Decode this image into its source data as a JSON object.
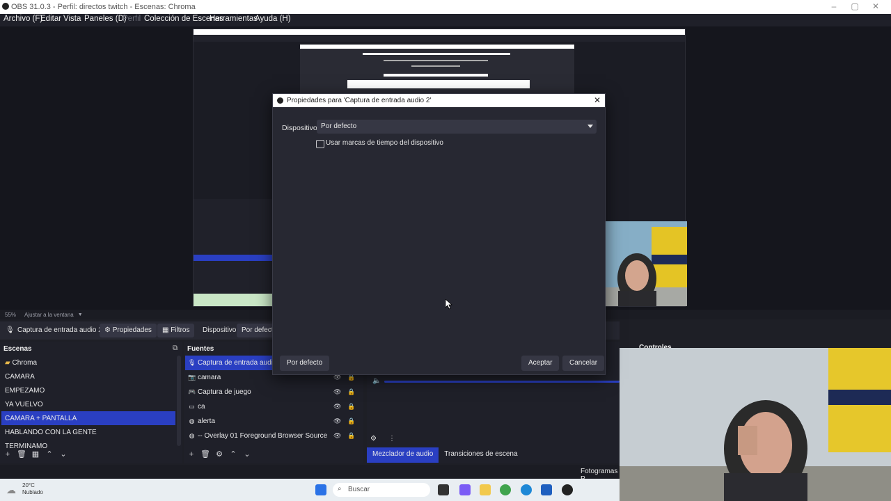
{
  "window": {
    "title": "OBS 31.0.3 - Perfil: directos twitch - Escenas: Chroma"
  },
  "menu": [
    {
      "label": "Archivo (F)",
      "enabled": true
    },
    {
      "label": "Editar",
      "enabled": true
    },
    {
      "label": "Vista",
      "enabled": true
    },
    {
      "label": "Paneles (D)",
      "enabled": true
    },
    {
      "label": "Perfil",
      "enabled": false
    },
    {
      "label": "Colección de Escenas",
      "enabled": true
    },
    {
      "label": "Herramientas",
      "enabled": true
    },
    {
      "label": "Ayuda (H)",
      "enabled": true
    }
  ],
  "preview": {
    "zoom": "55%",
    "fit_label": "Ajustar a la ventana"
  },
  "context_bar": {
    "source": "Captura de entrada audio 2",
    "properties": "Propiedades",
    "filters": "Filtros",
    "device_label": "Dispositivo",
    "device_value": "Por defecto"
  },
  "scenes": {
    "title": "Escenas",
    "items": [
      "Chroma",
      "CAMARA",
      "EMPEZAMO",
      "YA VUELVO",
      "CAMARA + PANTALLA",
      "HABLANDO CON LA GENTE",
      "TERMINAMO"
    ],
    "selected_index": 4
  },
  "sources": {
    "title": "Fuentes",
    "items": [
      "Captura de entrada audio 2",
      "camara",
      "Captura de juego",
      "ca",
      "alerta",
      "-- Overlay 01  Foreground Browser Source"
    ]
  },
  "mixer": {
    "tab_mixer": "Mezclador de audio",
    "tab_transitions": "Transiciones de escena",
    "controls_title": "Controles"
  },
  "statusbar": {
    "frames": "Fotogramas P"
  },
  "taskbar": {
    "temp": "20°C",
    "weather": "Nublado",
    "search": "Buscar"
  },
  "dialog": {
    "title": "Propiedades para 'Captura de entrada audio 2'",
    "device_label": "Dispositivo",
    "device_value": "Por defecto",
    "checkbox_label": "Usar marcas de tiempo del dispositivo",
    "checkbox_checked": false,
    "defaults_button": "Por defecto",
    "ok_button": "Aceptar",
    "cancel_button": "Cancelar"
  },
  "colors": {
    "accent": "#2a3fc2",
    "panel": "#1f2029",
    "background": "#15161d"
  }
}
